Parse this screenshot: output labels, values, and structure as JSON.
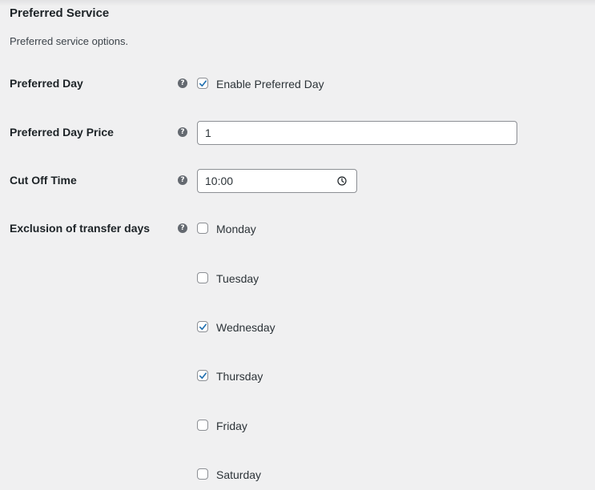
{
  "section": {
    "title": "Preferred Service",
    "description": "Preferred service options."
  },
  "help_icon_glyph": "?",
  "preferred_day": {
    "label": "Preferred Day",
    "checkbox_label": "Enable Preferred Day",
    "checked": true
  },
  "preferred_day_price": {
    "label": "Preferred Day Price",
    "value": "1"
  },
  "cut_off_time": {
    "label": "Cut Off Time",
    "value": "10:00",
    "icon": "clock-icon"
  },
  "exclusion": {
    "label": "Exclusion of transfer days",
    "days": [
      {
        "label": "Monday",
        "checked": false
      },
      {
        "label": "Tuesday",
        "checked": false
      },
      {
        "label": "Wednesday",
        "checked": true
      },
      {
        "label": "Thursday",
        "checked": true
      },
      {
        "label": "Friday",
        "checked": false
      },
      {
        "label": "Saturday",
        "checked": false
      }
    ]
  },
  "colors": {
    "background": "#f0f0f1",
    "check": "#2271b1",
    "border": "#8c8f94"
  }
}
